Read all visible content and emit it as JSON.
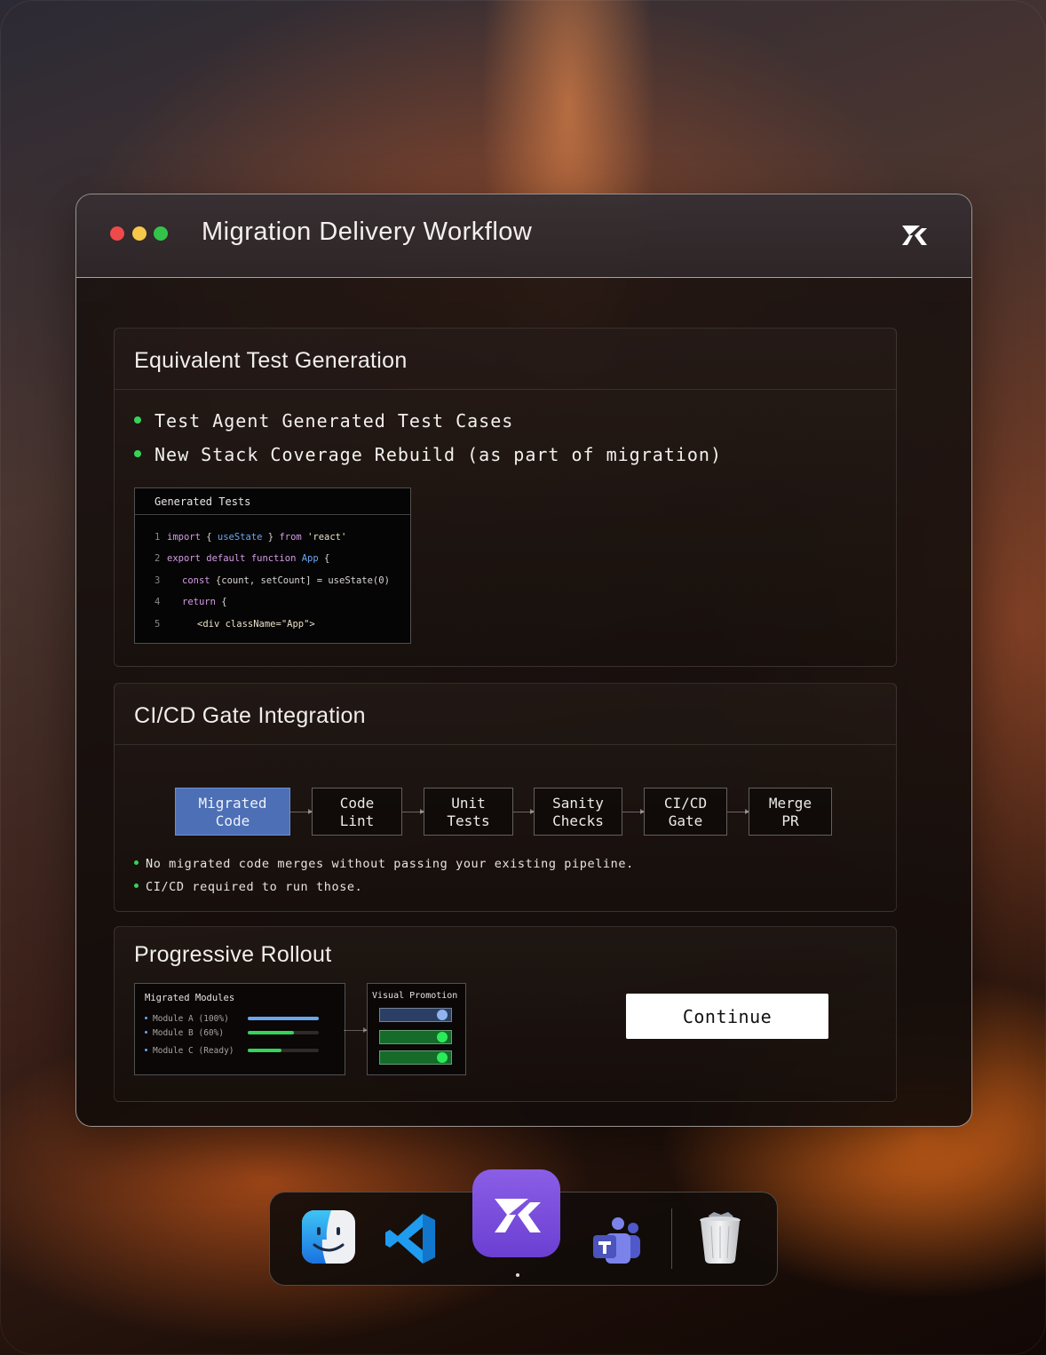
{
  "window": {
    "title": "Migration Delivery Workflow"
  },
  "test_generation": {
    "title": "Equivalent Test Generation",
    "bullets": [
      "Test Agent Generated Test Cases",
      "New Stack Coverage Rebuild (as part of migration)"
    ],
    "code_panel": {
      "title": "Generated Tests",
      "lines": [
        {
          "n": "1",
          "a": "import",
          "b": " { ",
          "c": "useState",
          "d": " } ",
          "e": "from",
          "f": " 'react'"
        },
        {
          "n": "2",
          "a": "export default function",
          "b": " ",
          "c": "App",
          "d": " {"
        },
        {
          "n": "3",
          "a": "const",
          "b": " {count, setCount] = useState(0)"
        },
        {
          "n": "4",
          "a": "return",
          "b": " {"
        },
        {
          "n": "5",
          "a": "<div className=\"App\">"
        }
      ]
    }
  },
  "cicd": {
    "title": "CI/CD Gate Integration",
    "stages": [
      {
        "l1": "Migrated",
        "l2": "Code"
      },
      {
        "l1": "Code",
        "l2": "Lint"
      },
      {
        "l1": "Unit",
        "l2": "Tests"
      },
      {
        "l1": "Sanity",
        "l2": "Checks"
      },
      {
        "l1": "CI/CD",
        "l2": "Gate"
      },
      {
        "l1": "Merge",
        "l2": "PR"
      }
    ],
    "notes": [
      "No migrated code merges without passing your existing pipeline.",
      "CI/CD required to run those."
    ]
  },
  "rollout": {
    "title": "Progressive Rollout",
    "modules_panel": {
      "title": "Migrated Modules",
      "modules": [
        {
          "label": "Module A (100%)",
          "progress": 1.0,
          "color": "#6aa6f0"
        },
        {
          "label": "Module B (60%)",
          "progress": 0.65,
          "color": "#35d35a"
        },
        {
          "label": "Module C (Ready)",
          "progress": 0.48,
          "color": "#35d35a"
        }
      ]
    },
    "promotion_panel": {
      "title": "Visual Promotion"
    },
    "continue_label": "Continue"
  },
  "colors": {
    "accent_blue": "#4c6fb5",
    "status_green": "#35d35a"
  },
  "dock": {
    "items": [
      "finder-icon",
      "vscode-icon",
      "app-logo-icon",
      "teams-icon",
      "trash-icon"
    ]
  }
}
